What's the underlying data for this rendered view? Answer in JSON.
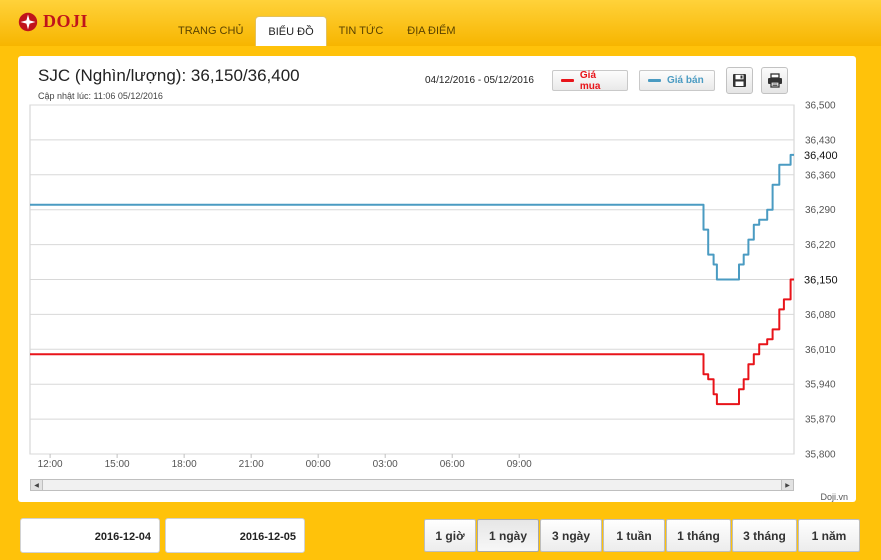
{
  "brand": {
    "name": "DOJI"
  },
  "nav": {
    "tabs": [
      "TRANG CHỦ",
      "BIỂU ĐỒ",
      "TIN TỨC",
      "ĐỊA ĐIỂM"
    ],
    "active": 1
  },
  "chart_panel": {
    "title": "SJC (Nghìn/lượng): 36,150/36,400",
    "updated": "Cập nhật lúc: 11:06 05/12/2016",
    "date_range": "04/12/2016 - 05/12/2016",
    "legend": [
      {
        "label": "Giá mua",
        "color": "#e8141a"
      },
      {
        "label": "Giá bán",
        "color": "#4a9bc2"
      }
    ],
    "tools": [
      "save-icon",
      "print-icon"
    ],
    "credit": "Doji.vn"
  },
  "chart_data": {
    "type": "line",
    "title": "SJC (Nghìn/lượng): 36,150/36,400",
    "x_ticks": [
      "12:00",
      "15:00",
      "18:00",
      "21:00",
      "00:00",
      "03:00",
      "06:00",
      "09:00"
    ],
    "x_range": [
      -0.3,
      11.1
    ],
    "x_unit": "hours relative to 12:00 on 04/12/2016",
    "ylim": [
      35800,
      36500
    ],
    "y_ticks": [
      36500,
      36430,
      36360,
      36290,
      36220,
      36150,
      36080,
      36010,
      35940,
      35870,
      35800
    ],
    "y_tick_labels": [
      "36,500",
      "36,430",
      "36,360",
      "36,290",
      "36,220",
      "36,150",
      "36,080",
      "36,010",
      "35,940",
      "35,870",
      "35,800"
    ],
    "current_labels": [
      {
        "value": 36400,
        "text": "36,400"
      },
      {
        "value": 36150,
        "text": "36,150"
      }
    ],
    "grid": true,
    "series": [
      {
        "name": "Giá mua",
        "color": "#e8141a",
        "x": [
          -0.3,
          9.7,
          9.75,
          9.82,
          9.9,
          9.95,
          10.05,
          10.15,
          10.25,
          10.28,
          10.35,
          10.42,
          10.5,
          10.58,
          10.66,
          10.7,
          10.78,
          10.88,
          10.95,
          11.05,
          11.1
        ],
        "y": [
          36000,
          36000,
          35960,
          35950,
          35920,
          35900,
          35900,
          35900,
          35900,
          35930,
          35950,
          35980,
          36000,
          36020,
          36020,
          36030,
          36050,
          36090,
          36110,
          36150,
          36150
        ]
      },
      {
        "name": "Giá bán",
        "color": "#4a9bc2",
        "x": [
          -0.3,
          9.7,
          9.75,
          9.82,
          9.9,
          9.95,
          10.05,
          10.15,
          10.25,
          10.28,
          10.35,
          10.42,
          10.5,
          10.58,
          10.66,
          10.7,
          10.78,
          10.88,
          10.95,
          11.05,
          11.1
        ],
        "y": [
          36300,
          36300,
          36250,
          36200,
          36180,
          36150,
          36150,
          36150,
          36150,
          36180,
          36200,
          36230,
          36260,
          36270,
          36270,
          36290,
          36340,
          36380,
          36380,
          36400,
          36400
        ]
      }
    ]
  },
  "date_inputs": [
    "2016-12-04",
    "2016-12-05"
  ],
  "ranges": {
    "items": [
      "1 giờ",
      "1 ngày",
      "3 ngày",
      "1 tuần",
      "1 tháng",
      "3 tháng",
      "1 năm"
    ],
    "active": 1
  }
}
